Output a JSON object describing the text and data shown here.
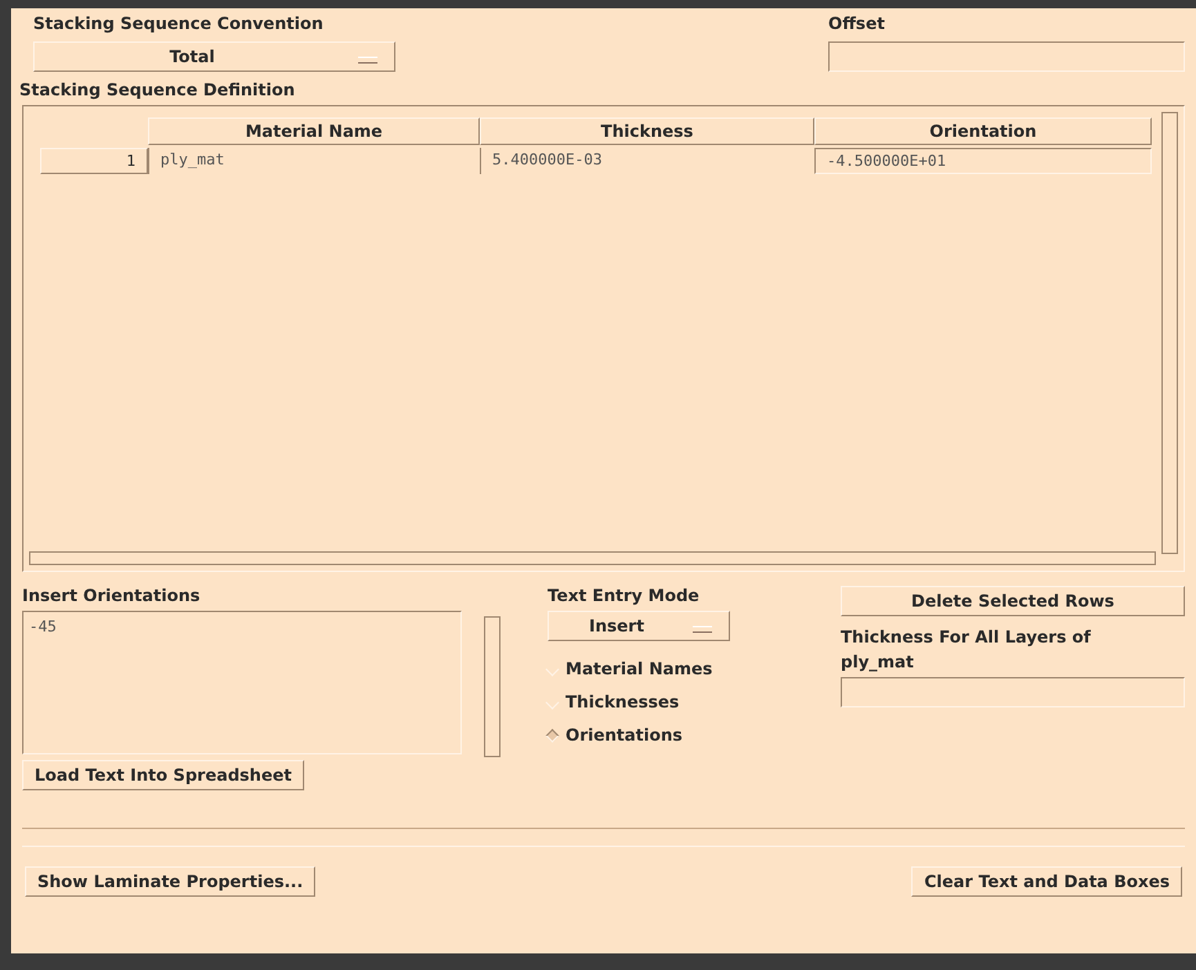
{
  "convention": {
    "label": "Stacking Sequence Convention",
    "value": "Total"
  },
  "offset": {
    "label": "Offset"
  },
  "definition": {
    "label": "Stacking Sequence Definition",
    "columns": [
      "Material Name",
      "Thickness",
      "Orientation"
    ],
    "rows": [
      {
        "index": "1",
        "cells": [
          "ply_mat",
          "5.400000E-03",
          "-4.500000E+01"
        ]
      }
    ]
  },
  "insert": {
    "label": "Insert Orientations",
    "value": "-45",
    "button": "Load Text Into Spreadsheet"
  },
  "mode": {
    "label": "Text Entry Mode",
    "value": "Insert",
    "options": [
      {
        "label": "Material Names",
        "selected": false
      },
      {
        "label": "Thicknesses",
        "selected": false
      },
      {
        "label": "Orientations",
        "selected": true
      }
    ]
  },
  "delete_button": "Delete Selected Rows",
  "thickness": {
    "label": "Thickness For All Layers of",
    "material": "ply_mat"
  },
  "footer": {
    "left": "Show Laminate Properties...",
    "right": "Clear Text and Data Boxes"
  }
}
